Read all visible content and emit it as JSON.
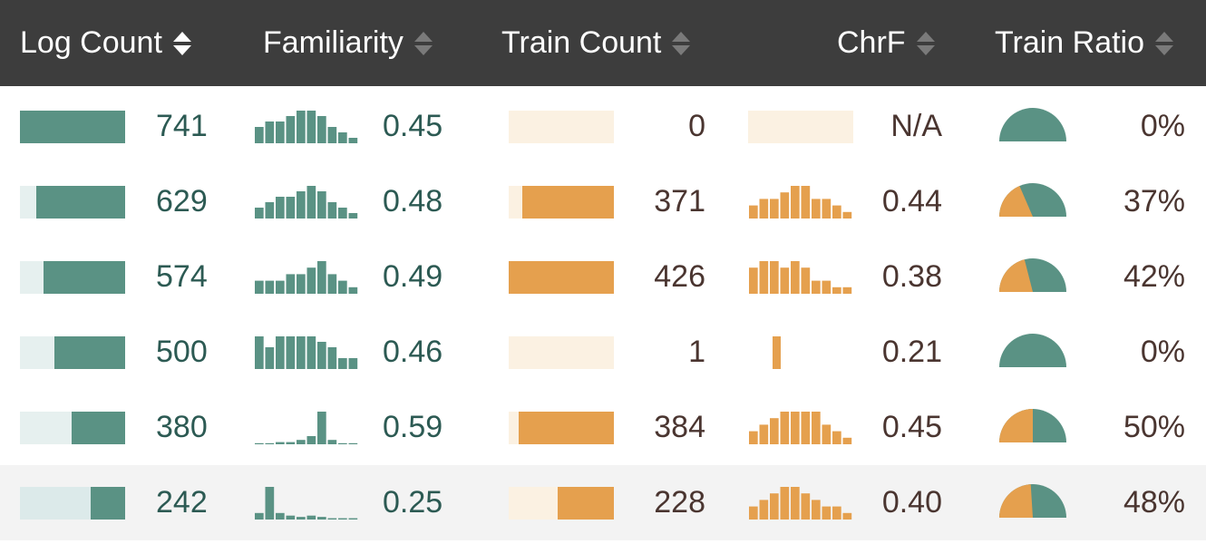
{
  "table": {
    "columns": [
      {
        "label": "Log Count",
        "sort": "descending"
      },
      {
        "label": "Familiarity",
        "sort": "none"
      },
      {
        "label": "Train Count",
        "sort": "none"
      },
      {
        "label": "ChrF",
        "sort": "none"
      },
      {
        "label": "Train Ratio",
        "sort": "none"
      }
    ],
    "max_log_count": 741,
    "max_train_count": 426,
    "rows": [
      {
        "log_count": "741",
        "log_value": 741,
        "familiarity": "0.45",
        "familiarity_hist": [
          3,
          4,
          4,
          5,
          6,
          6,
          5,
          3,
          2,
          1
        ],
        "train_count": "0",
        "train_value": 0,
        "chrf": "N/A",
        "chrf_hist": [],
        "train_ratio": "0%",
        "ratio_value": 0
      },
      {
        "log_count": "629",
        "log_value": 629,
        "familiarity": "0.48",
        "familiarity_hist": [
          2,
          3,
          4,
          4,
          5,
          6,
          5,
          3,
          2,
          1
        ],
        "train_count": "371",
        "train_value": 371,
        "chrf": "0.44",
        "chrf_hist": [
          2,
          3,
          3,
          4,
          5,
          5,
          3,
          3,
          2,
          1
        ],
        "train_ratio": "37%",
        "ratio_value": 0.37
      },
      {
        "log_count": "574",
        "log_value": 574,
        "familiarity": "0.49",
        "familiarity_hist": [
          2,
          2,
          2,
          3,
          3,
          4,
          5,
          3,
          2,
          1
        ],
        "train_count": "426",
        "train_value": 426,
        "chrf": "0.38",
        "chrf_hist": [
          4,
          5,
          5,
          4,
          5,
          4,
          2,
          2,
          1,
          1
        ],
        "train_ratio": "42%",
        "ratio_value": 0.42
      },
      {
        "log_count": "500",
        "log_value": 500,
        "familiarity": "0.46",
        "familiarity_hist": [
          6,
          4,
          6,
          6,
          6,
          6,
          5,
          4,
          2,
          2
        ],
        "train_count": "1",
        "train_value": 1,
        "chrf": "0.21",
        "chrf_hist": [
          5
        ],
        "train_ratio": "0%",
        "ratio_value": 0
      },
      {
        "log_count": "380",
        "log_value": 380,
        "familiarity": "0.59",
        "familiarity_hist": [
          0.2,
          0.2,
          0.4,
          0.4,
          0.8,
          1.5,
          6,
          0.8,
          0,
          0
        ],
        "train_count": "384",
        "train_value": 384,
        "chrf": "0.45",
        "chrf_hist": [
          2,
          3,
          4,
          5,
          5,
          5,
          5,
          3,
          2,
          1
        ],
        "train_ratio": "50%",
        "ratio_value": 0.5
      },
      {
        "log_count": "242",
        "log_value": 242,
        "familiarity": "0.25",
        "familiarity_hist": [
          1,
          5,
          1,
          0.6,
          0.4,
          0.6,
          0.4,
          0.2,
          0.2,
          0.2
        ],
        "train_count": "228",
        "train_value": 228,
        "chrf": "0.40",
        "chrf_hist": [
          2,
          3,
          4,
          5,
          5,
          4,
          3,
          2,
          2,
          1
        ],
        "train_ratio": "48%",
        "ratio_value": 0.48
      }
    ]
  },
  "colors": {
    "header_bg": "#3d3d3d",
    "teal": "#5a9284",
    "teal_track": "#e6f0ef",
    "orange": "#e5a04e",
    "orange_track": "#fbf1e2",
    "row_highlight": "#f3f3f3"
  }
}
